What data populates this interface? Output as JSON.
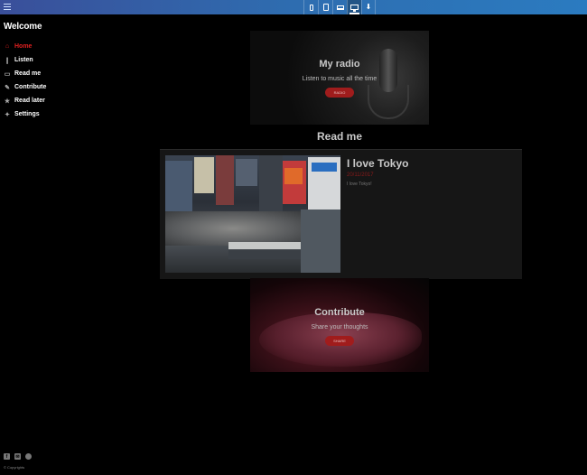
{
  "sidebar": {
    "title": "Welcome",
    "items": [
      {
        "label": "Home",
        "icon": "home-icon",
        "active": true
      },
      {
        "label": "Listen",
        "icon": "microphone-icon",
        "active": false
      },
      {
        "label": "Read me",
        "icon": "book-icon",
        "active": false
      },
      {
        "label": "Contribute",
        "icon": "edit-icon",
        "active": false
      },
      {
        "label": "Read later",
        "icon": "star-icon",
        "active": false
      },
      {
        "label": "Settings",
        "icon": "wrench-icon",
        "active": false
      }
    ],
    "social": [
      "facebook-icon",
      "mail-icon",
      "github-icon"
    ],
    "copyright": "© Copyrights"
  },
  "radio": {
    "title": "My radio",
    "subtitle": "Listen to music all the time",
    "button": "RADIO"
  },
  "read_me": {
    "title": "Read me",
    "card": {
      "title": "I love Tokyo",
      "date": "20/11/2017",
      "text": "I love Tokyo!"
    }
  },
  "contribute": {
    "title": "Contribute",
    "subtitle": "Share your thoughts",
    "button": "SHARE"
  },
  "colors": {
    "accent": "#e02020",
    "topbar": "#2e6db0",
    "button": "#a01c1c"
  }
}
